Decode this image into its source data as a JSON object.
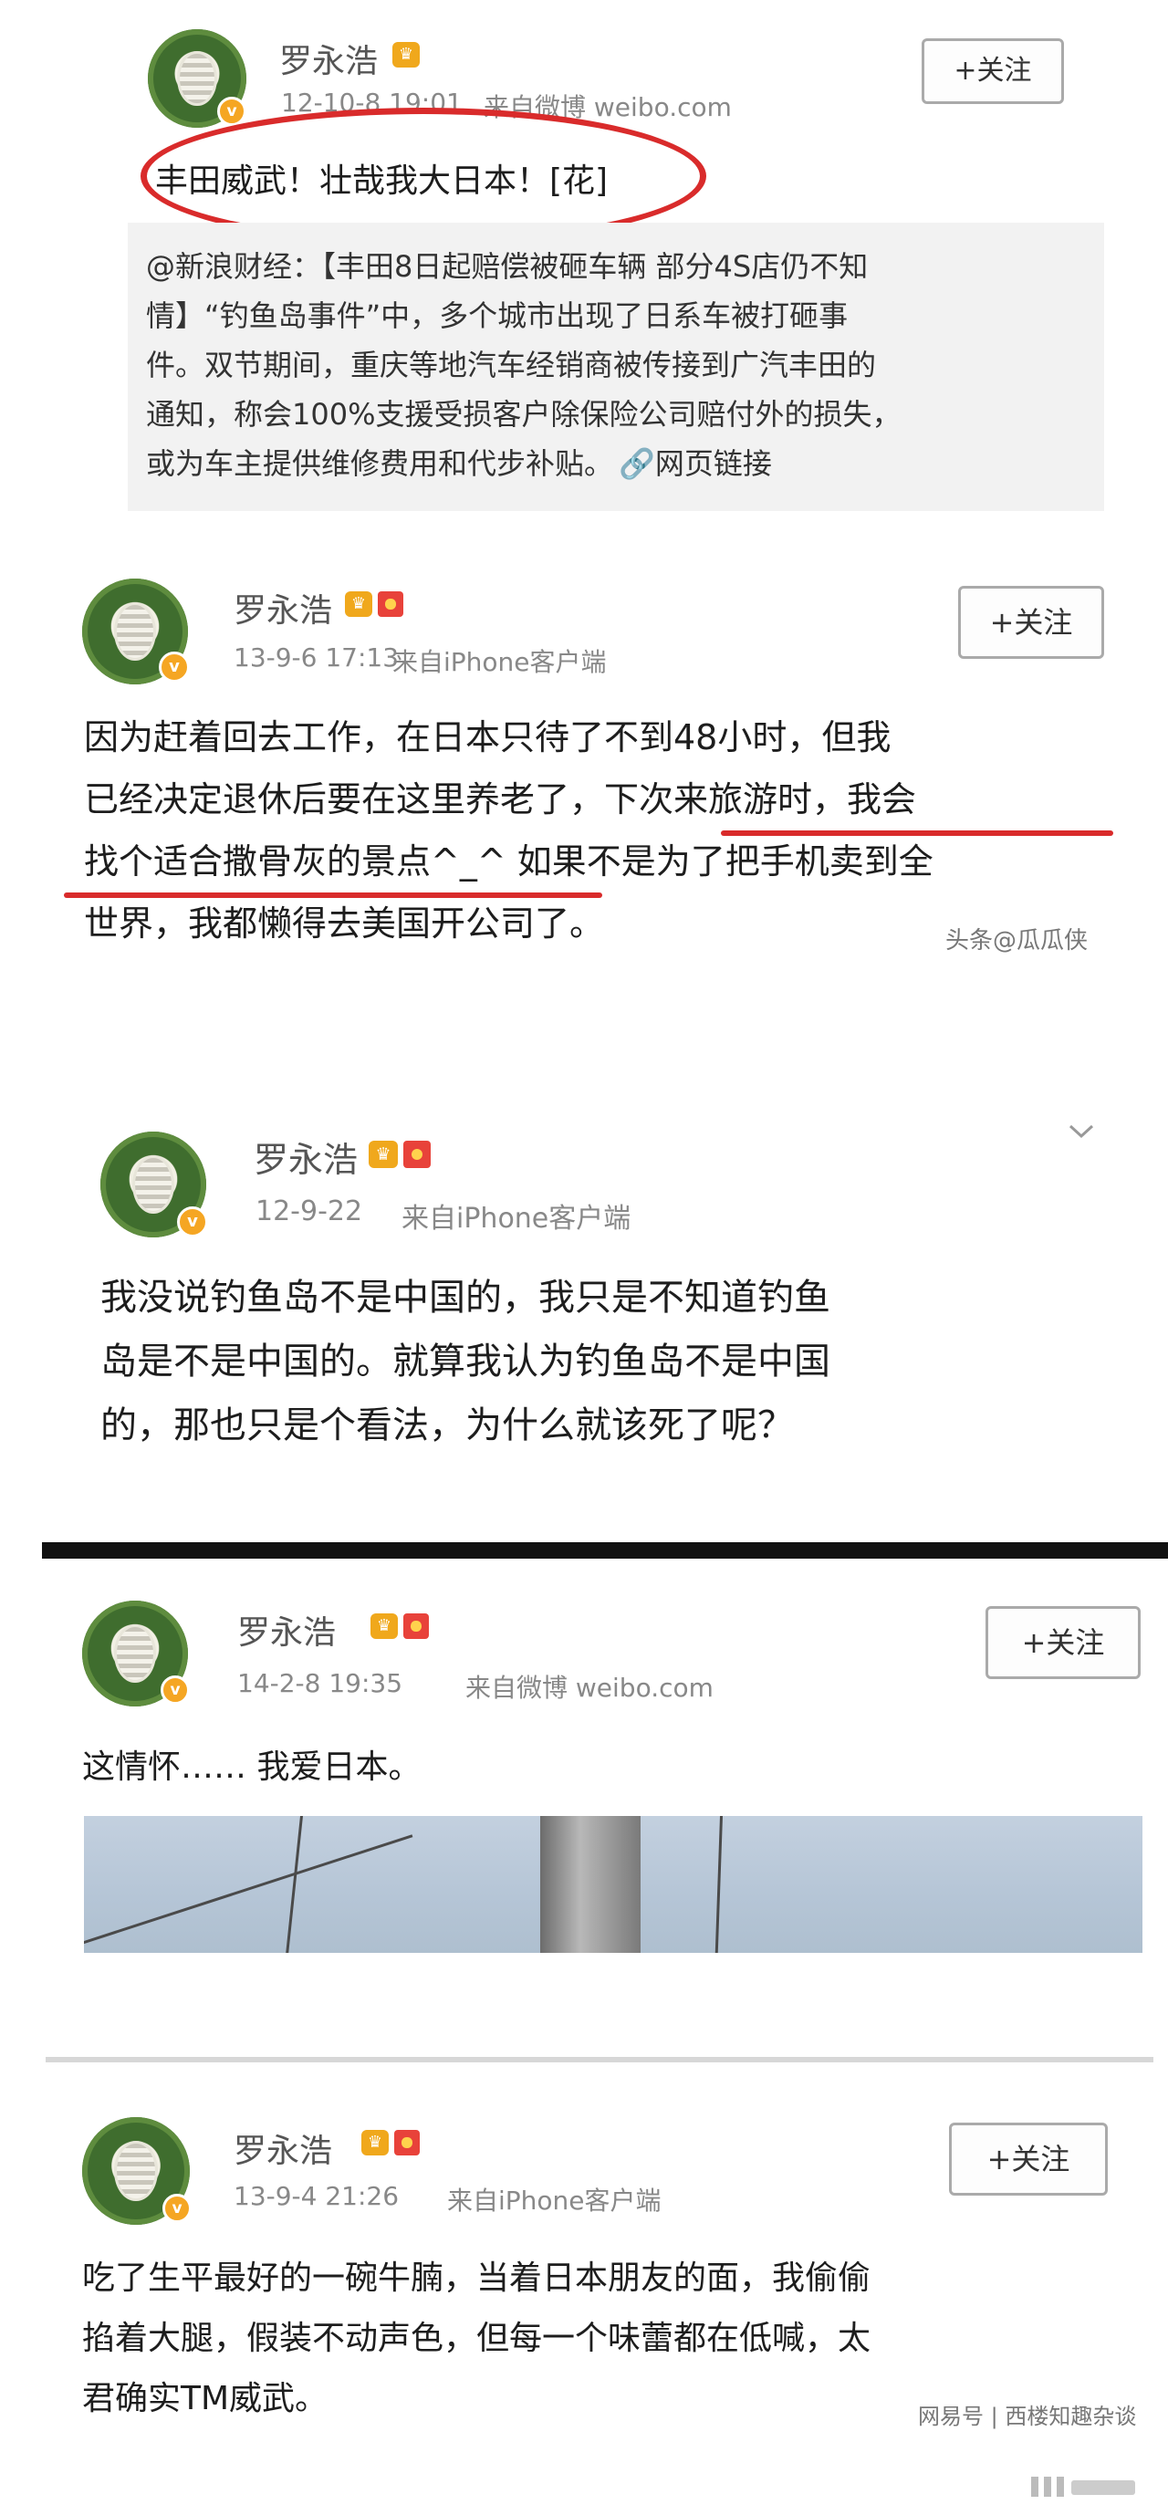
{
  "posts": [
    {
      "username": "罗永浩",
      "time": "12-10-8 19:01",
      "source": "来自微博 weibo.com",
      "follow_label": "+关注",
      "text": "丰田威武！壮哉我大日本！[花]",
      "repost": {
        "line1": "@新浪财经：【丰田8日起赔偿被砸车辆 部分4S店仍不知",
        "line2": "情】“钓鱼岛事件”中，多个城市出现了日系车被打砸事",
        "line3": "件。双节期间，重庆等地汽车经销商被传接到广汽丰田的",
        "line4": "通知，称会100%支援受损客户除保险公司赔付外的损失，",
        "line5": "或为车主提供维修费用和代步补贴。",
        "link_label": "网页链接"
      }
    },
    {
      "username": "罗永浩",
      "time": "13-9-6 17:13",
      "source": "来自iPhone客户端",
      "follow_label": "+关注",
      "line1": "因为赶着回去工作，在日本只待了不到48小时，但我",
      "line2": "已经决定退休后要在这里养老了，下次来旅游时，我会",
      "line3": "找个适合撒骨灰的景点^_^ 如果不是为了把手机卖到全",
      "line4": "世界，我都懒得去美国开公司了。",
      "watermark": "头条@瓜瓜侠"
    },
    {
      "username": "罗永浩",
      "time": "12-9-22",
      "source": "来自iPhone客户端",
      "line1": "我没说钓鱼岛不是中国的，我只是不知道钓鱼",
      "line2": "岛是不是中国的。就算我认为钓鱼岛不是中国",
      "line3": "的，那也只是个看法，为什么就该死了呢？"
    },
    {
      "username": "罗永浩",
      "time": "14-2-8 19:35",
      "source": "来自微博 weibo.com",
      "follow_label": "+关注",
      "text": "这情怀…… 我爱日本。"
    },
    {
      "username": "罗永浩",
      "time": "13-9-4 21:26",
      "source": "来自iPhone客户端",
      "follow_label": "+关注",
      "line1": "吃了生平最好的一碗牛腩，当着日本朋友的面，我偷偷",
      "line2": "掐着大腿，假装不动声色，但每一个味蕾都在低喊，太",
      "line3": "君确实TM威武。",
      "watermark": "网易号 | 西楼知趣杂谈"
    }
  ],
  "colors": {
    "accent_red": "#d92b2b",
    "verified": "#f5a623"
  }
}
